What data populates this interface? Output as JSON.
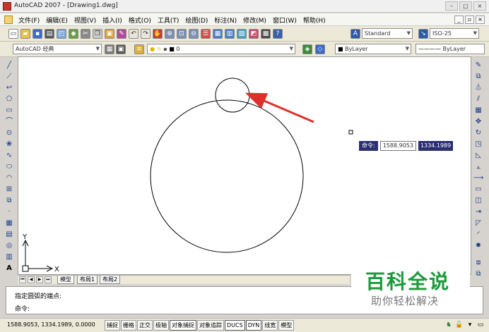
{
  "window": {
    "title": "AutoCAD 2007 - [Drawing1.dwg]"
  },
  "menubar": {
    "items": [
      "文件(F)",
      "编辑(E)",
      "视图(V)",
      "插入(I)",
      "格式(O)",
      "工具(T)",
      "绘图(D)",
      "标注(N)",
      "修改(M)",
      "窗口(W)",
      "帮助(H)"
    ]
  },
  "toolbar1": {
    "text_style": "Standard",
    "dim_style": "ISO-25"
  },
  "toolbar2": {
    "workspace": "AutoCAD 经典",
    "layer": "0",
    "color": "ByLayer",
    "linetype": "ByLayer",
    "lineweight": "ByLayer"
  },
  "drawing": {
    "ucs": {
      "y_label": "Y",
      "x_label": "X"
    },
    "cmd_tip": {
      "label": "命令:",
      "x_value": "1588.9053",
      "y_value": "1334.1989"
    }
  },
  "layout_tabs": [
    "模型",
    "布局1",
    "布局2"
  ],
  "command": {
    "history_line": "指定圆弧的端点:",
    "prompt": "命令:"
  },
  "status": {
    "coordinates": "1588.9053,  1334.1989, 0.0000",
    "toggles": [
      "捕捉",
      "栅格",
      "正交",
      "极轴",
      "对象捕捉",
      "对象追踪",
      "DUCS",
      "DYN",
      "线宽",
      "模型"
    ]
  },
  "watermark": {
    "title": "百科全说",
    "subtitle": "助你轻松解决"
  },
  "colors": {
    "arrow": "#e0302b",
    "cmd_bg": "#2b2f72",
    "watermark_green": "#1a9a3c"
  }
}
